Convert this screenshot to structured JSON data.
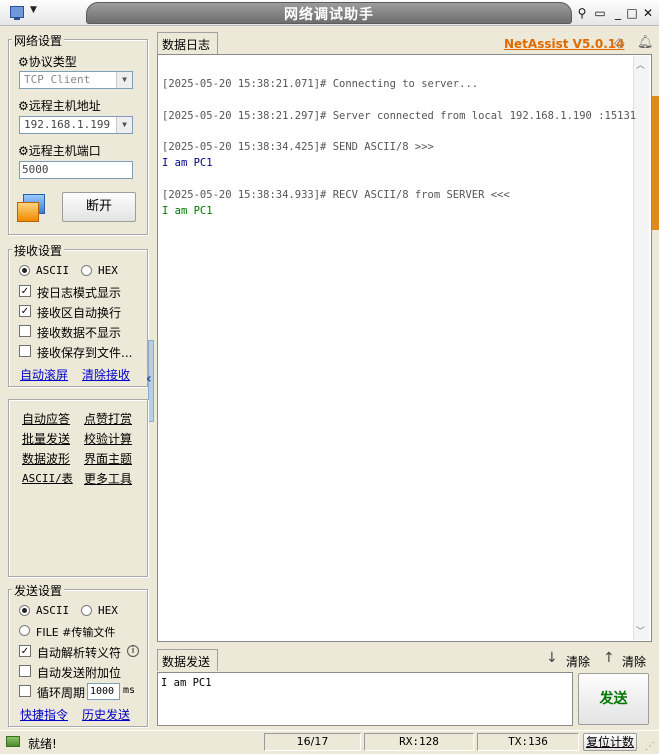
{
  "window": {
    "title": "网络调试助手"
  },
  "net_settings": {
    "legend": "网络设置",
    "protocol_label": "协议类型",
    "protocol_value": "TCP Client",
    "remote_host_label": "远程主机地址",
    "remote_host_value": "192.168.1.199",
    "remote_port_label": "远程主机端口",
    "remote_port_value": "5000",
    "disconnect_label": "断开"
  },
  "recv_settings": {
    "legend": "接收设置",
    "ascii_label": "ASCII",
    "hex_label": "HEX",
    "encoding_selected": "ASCII",
    "options": [
      {
        "label": "按日志模式显示",
        "checked": true
      },
      {
        "label": "接收区自动换行",
        "checked": true
      },
      {
        "label": "接收数据不显示",
        "checked": false
      },
      {
        "label": "接收保存到文件...",
        "checked": false
      }
    ],
    "auto_scroll_link": "自动滚屏",
    "clear_recv_link": "清除接收"
  },
  "tools": {
    "links": [
      "自动应答",
      "点赞打赏",
      "批量发送",
      "校验计算",
      "数据波形",
      "界面主题",
      "ASCII/表",
      "更多工具"
    ]
  },
  "send_settings": {
    "legend": "发送设置",
    "ascii_label": "ASCII",
    "hex_label": "HEX",
    "encoding_selected": "ASCII",
    "file_label": "FILE #传输文件",
    "auto_escape_label": "自动解析转义符",
    "auto_escape_checked": true,
    "append_label": "自动发送附加位",
    "append_checked": false,
    "loop_label": "循环周期",
    "loop_value": "1000",
    "loop_unit": "ms",
    "loop_checked": false,
    "shortcut_link": "快捷指令",
    "history_link": "历史发送"
  },
  "log_panel": {
    "tab_label": "数据日志",
    "brand": "NetAssist V5.0.14",
    "entries": [
      {
        "ts": "[2025-05-20 15:38:21.071]#",
        "msg": " Connecting to server...",
        "data": ""
      },
      {
        "ts": "[2025-05-20 15:38:21.297]#",
        "msg": " Server connected from local 192.168.1.190 :15131",
        "data": ""
      },
      {
        "ts": "[2025-05-20 15:38:34.425]#",
        "msg": " SEND ASCII/8 >>>",
        "data": "I am PC1"
      },
      {
        "ts": "[2025-05-20 15:38:34.933]#",
        "msg": " RECV ASCII/8 from SERVER <<<",
        "data": "I am PC1"
      }
    ]
  },
  "send_panel": {
    "tab_label": "数据发送",
    "clear1_label": "清除",
    "clear2_label": "清除",
    "text": "I am PC1",
    "send_label": "发送"
  },
  "status_bar": {
    "status_text": "就绪!",
    "count": "16/17",
    "rx": "RX:128",
    "tx": "TX:136",
    "reset_label": "复位计数"
  },
  "colors": {
    "brand": "#e06a00",
    "send_button_text": "#007700",
    "recv_data": "#007700",
    "send_data": "#000088"
  }
}
